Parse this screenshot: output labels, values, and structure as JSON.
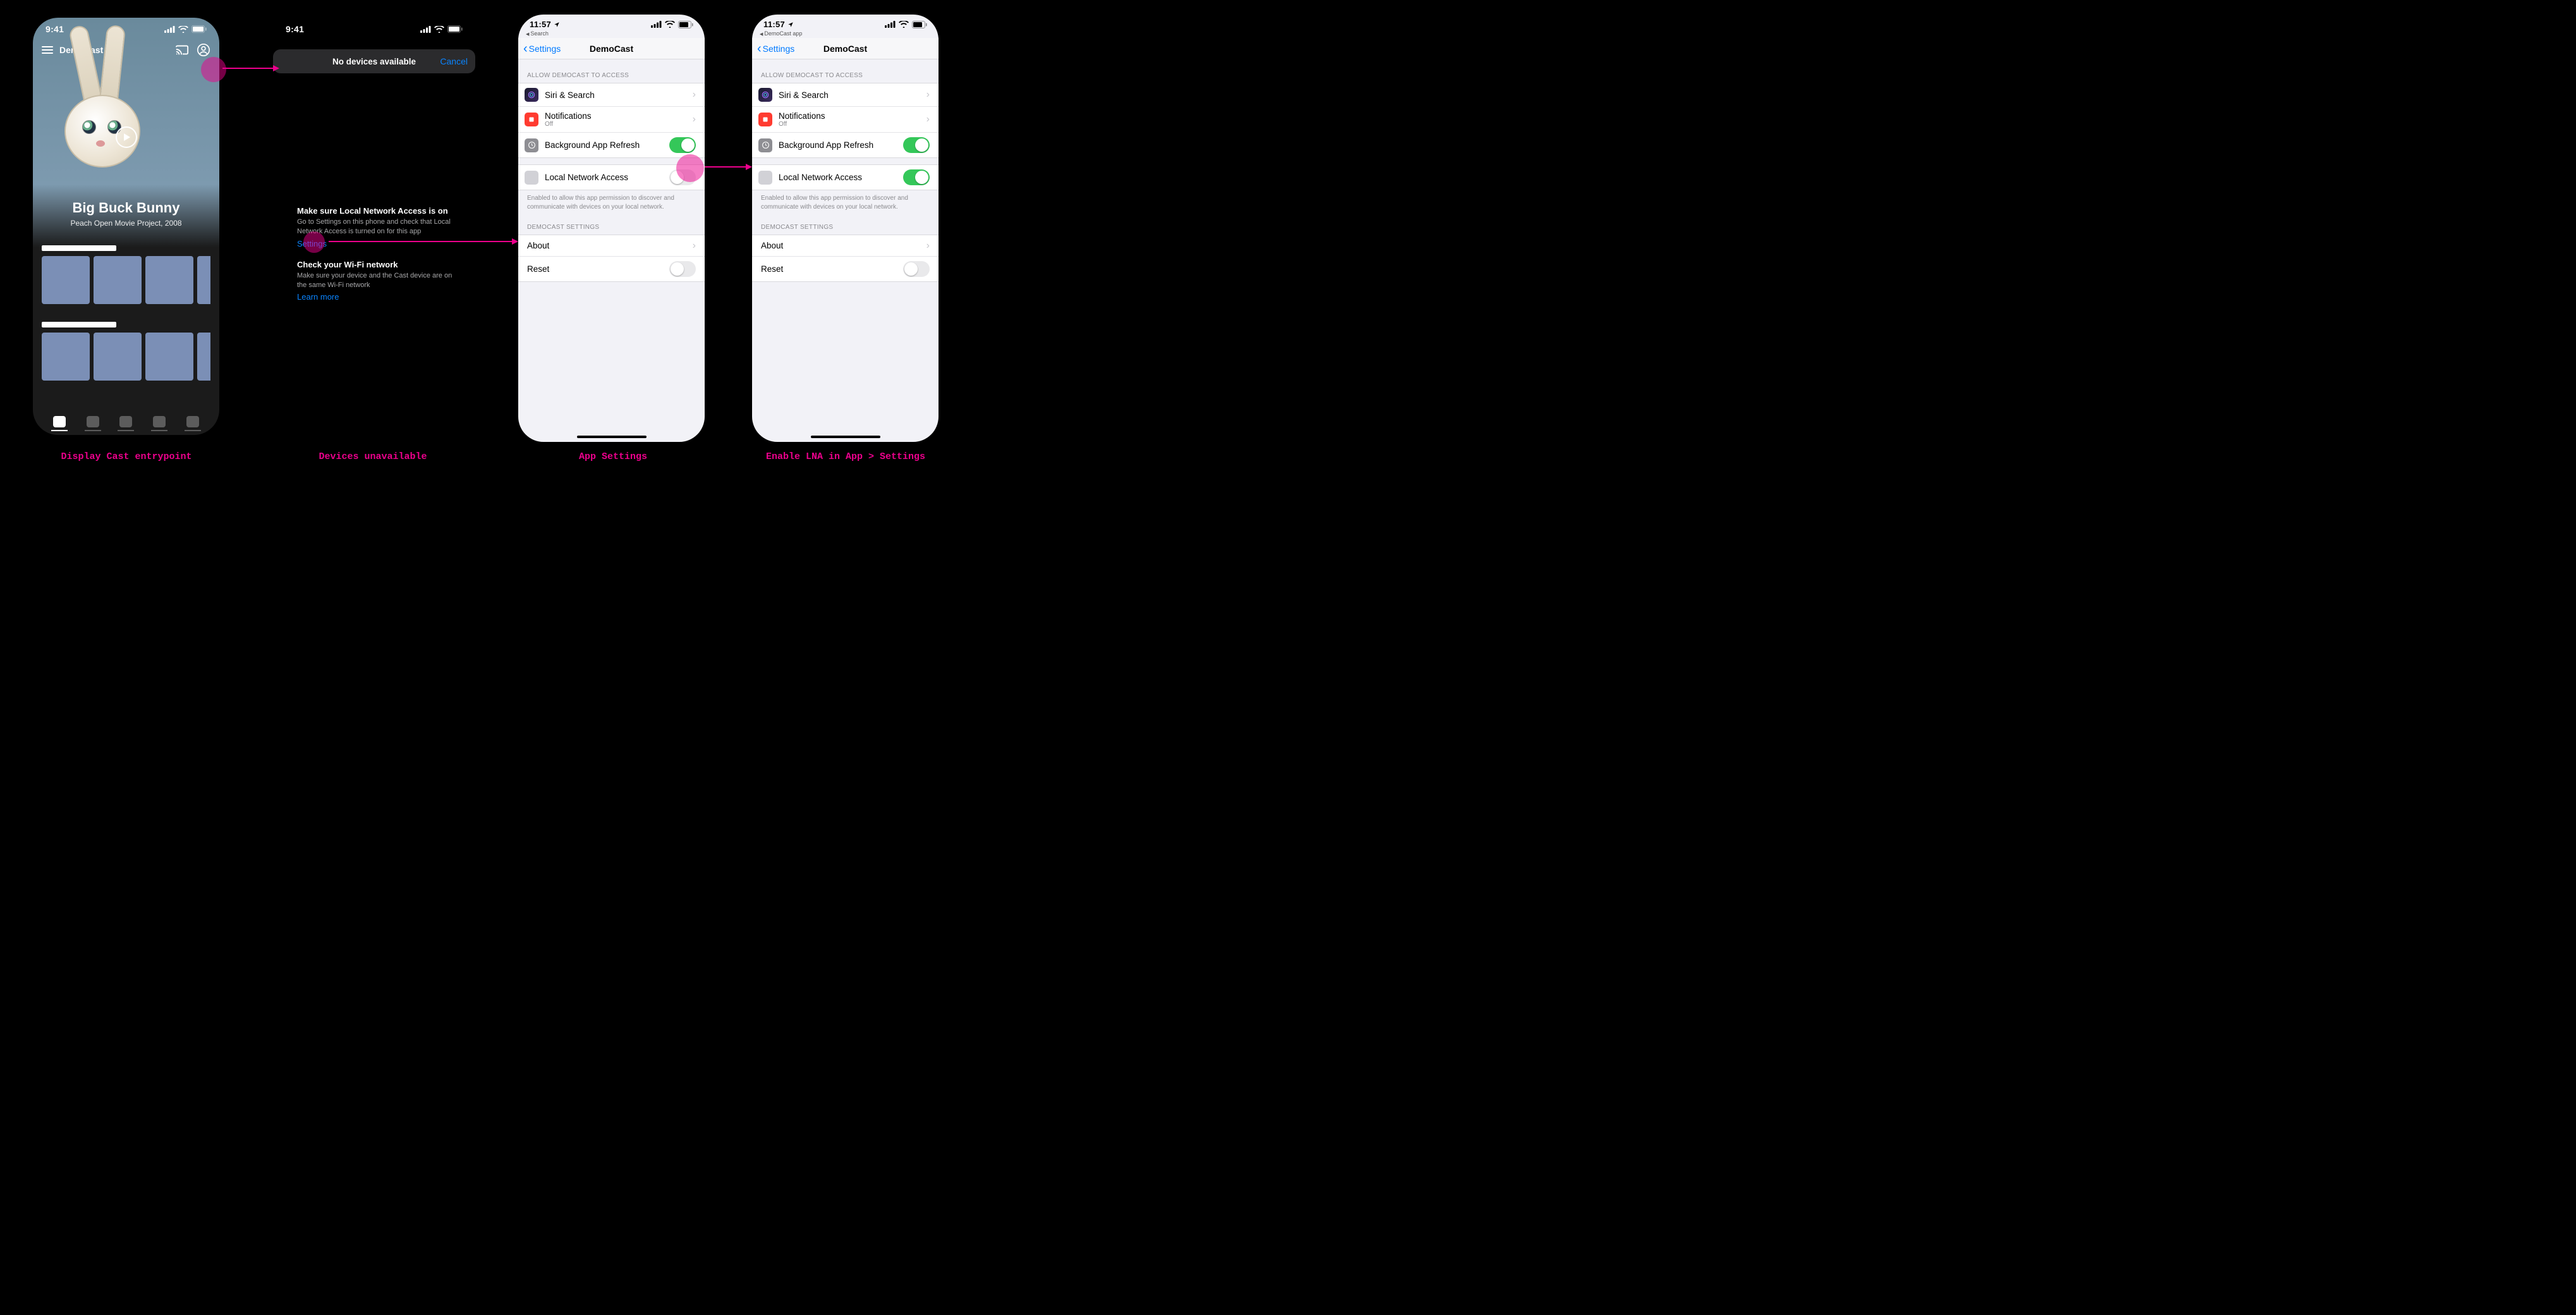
{
  "captions": {
    "c1": "Display Cast entrypoint",
    "c2": "Devices unavailable",
    "c3": "App Settings",
    "c4": "Enable LNA in App > Settings"
  },
  "s1": {
    "status_time": "9:41",
    "app_name": "DemoCast",
    "movie_title": "Big Buck Bunny",
    "movie_sub": "Peach Open Movie Project, 2008"
  },
  "s2": {
    "status_time": "9:41",
    "sheet_title": "No devices available",
    "cancel": "Cancel",
    "b1_h": "Make sure Local Network Access is on",
    "b1_p": "Go to Settings on this phone and check that Local Network Access is turned on for this app",
    "b1_link": "Settings",
    "b2_h": "Check your Wi-Fi network",
    "b2_p": "Make sure your device and the Cast device are on the same Wi-Fi network",
    "b2_link": "Learn more"
  },
  "ios": {
    "status_time": "11:57",
    "back_label": "Settings",
    "nav_title": "DemoCast",
    "sec1_header": "ALLOW DEMOCAST TO ACCESS",
    "row_siri": "Siri & Search",
    "row_notif": "Notifications",
    "row_notif_sub": "Off",
    "row_refresh": "Background App Refresh",
    "row_lna": "Local Network Access",
    "lna_footer": "Enabled to allow this app permission to discover and communicate with devices on your local network.",
    "sec2_header": "DEMOCAST SETTINGS",
    "row_about": "About",
    "row_reset": "Reset"
  },
  "breadcrumbs": {
    "s3": "Search",
    "s4": "DemoCast app"
  }
}
